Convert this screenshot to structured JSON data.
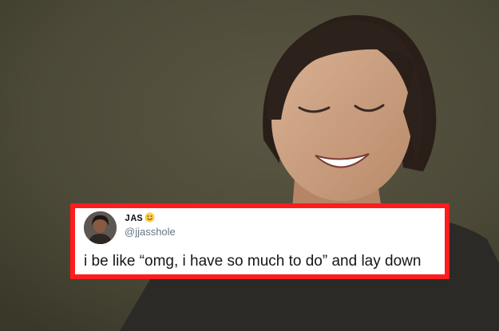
{
  "tweet": {
    "display_name": "JAS",
    "name_emoji": "slightly-smiling-face-icon",
    "handle": "@jjasshole",
    "text": "i be like “omg, i have so much to do” and lay down"
  },
  "colors": {
    "background": "#4d4a38",
    "frame": "#ff1c1c",
    "card": "#ffffff",
    "handle": "#657786",
    "text": "#14171a"
  }
}
